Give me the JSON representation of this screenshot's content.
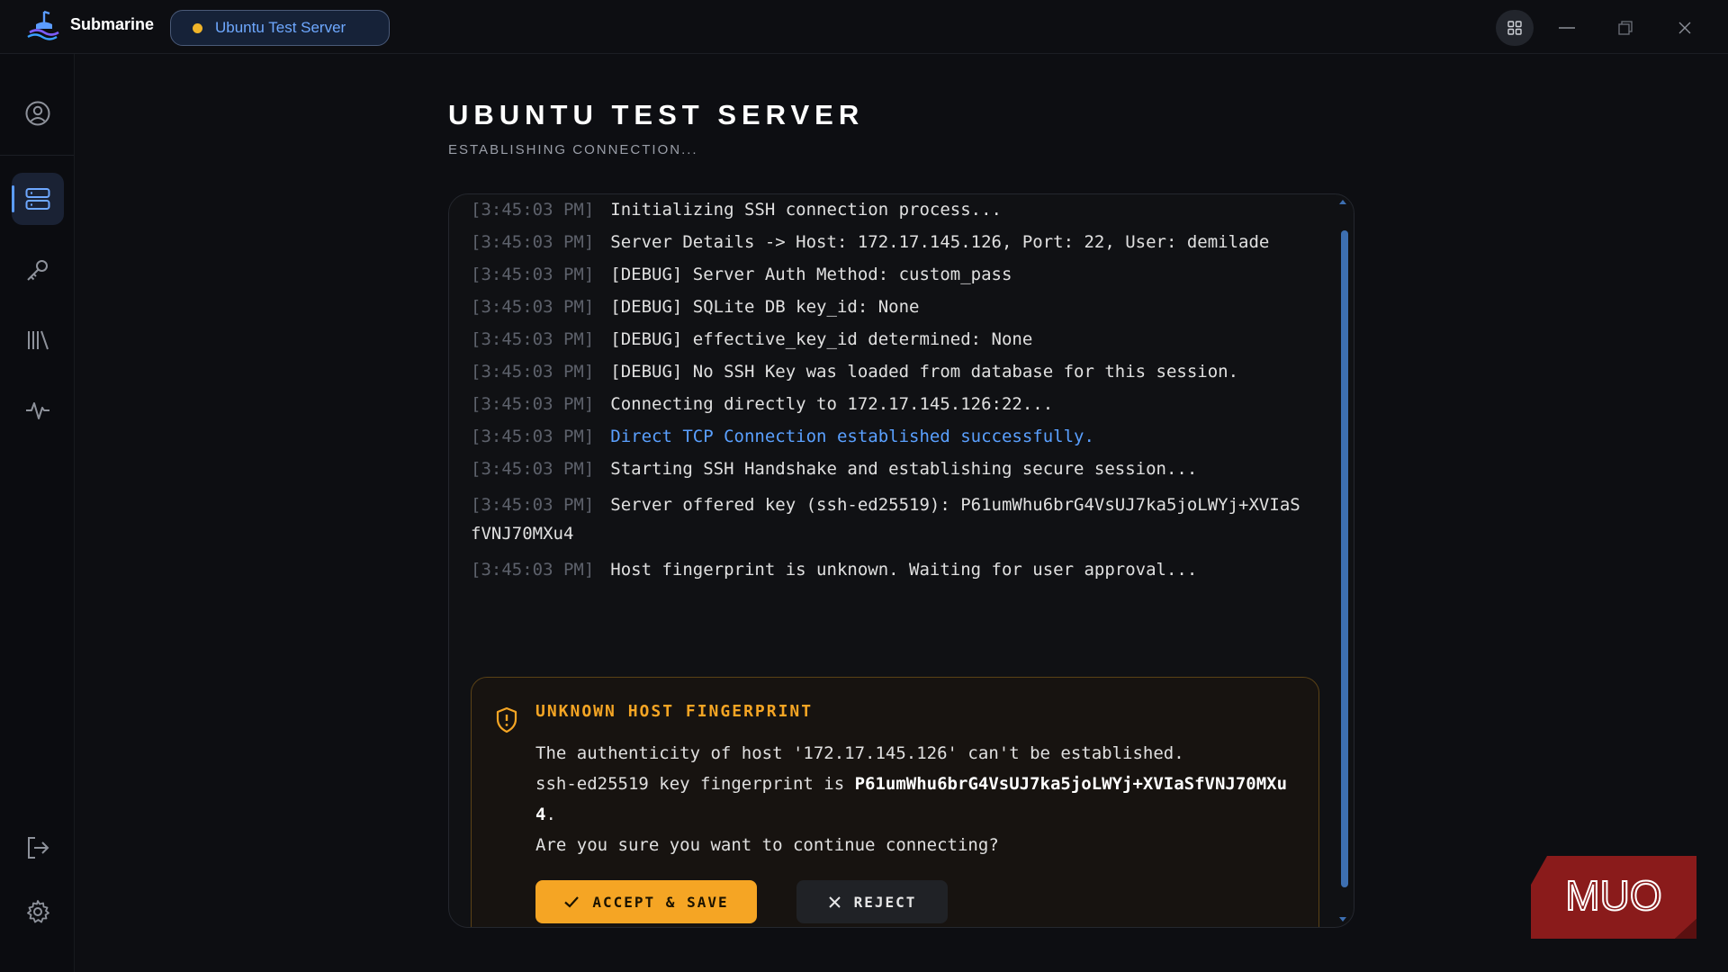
{
  "app": {
    "name": "Submarine"
  },
  "session_tab": {
    "label": "Ubuntu Test Server",
    "status_color": "#f0b429"
  },
  "window_controls": [
    "layout-grid-icon",
    "minimize-icon",
    "restore-icon",
    "close-icon"
  ],
  "sidebar": {
    "items": [
      {
        "name": "profile",
        "icon": "user-circle-icon"
      },
      {
        "name": "servers",
        "icon": "server-icon",
        "active": true
      },
      {
        "name": "keys",
        "icon": "key-icon"
      },
      {
        "name": "library",
        "icon": "library-icon"
      },
      {
        "name": "activity",
        "icon": "activity-pulse-icon"
      },
      {
        "name": "logout",
        "icon": "logout-icon"
      },
      {
        "name": "settings",
        "icon": "gear-icon"
      }
    ]
  },
  "page": {
    "title": "UBUNTU TEST SERVER",
    "subtitle": "ESTABLISHING CONNECTION..."
  },
  "log": [
    {
      "ts": "[3:45:03 PM]",
      "msg": "Initializing SSH connection process..."
    },
    {
      "ts": "[3:45:03 PM]",
      "msg": "Server Details -> Host: 172.17.145.126, Port: 22, User: demilade"
    },
    {
      "ts": "[3:45:03 PM]",
      "msg": "[DEBUG] Server Auth Method: custom_pass"
    },
    {
      "ts": "[3:45:03 PM]",
      "msg": "[DEBUG] SQLite DB key_id: None"
    },
    {
      "ts": "[3:45:03 PM]",
      "msg": "[DEBUG] effective_key_id determined: None"
    },
    {
      "ts": "[3:45:03 PM]",
      "msg": "[DEBUG] No SSH Key was loaded from database for this session."
    },
    {
      "ts": "[3:45:03 PM]",
      "msg": "Connecting directly to 172.17.145.126:22..."
    },
    {
      "ts": "[3:45:03 PM]",
      "msg": "Direct TCP Connection established successfully.",
      "level": "info"
    },
    {
      "ts": "[3:45:03 PM]",
      "msg": "Starting SSH Handshake and establishing secure session..."
    },
    {
      "ts": "[3:45:03 PM]",
      "msg": "Server offered key (ssh-ed25519): P61umWhu6brG4VsUJ7ka5joLWYj+XVIaSfVNJ70MXu4"
    },
    {
      "ts": "[3:45:03 PM]",
      "msg": "Host fingerprint is unknown. Waiting for user approval..."
    }
  ],
  "alert": {
    "icon": "shield-alert-icon",
    "title": "UNKNOWN HOST FINGERPRINT",
    "line1": "The authenticity of host '172.17.145.126' can't be established.",
    "line2_prefix": "ssh-ed25519 key fingerprint is ",
    "fingerprint": "P61umWhu6brG4VsUJ7ka5joLWYj+XVIaSfVNJ70MXu4",
    "line2_suffix": ".",
    "line3": "Are you sure you want to continue connecting?",
    "accept_label": "ACCEPT & SAVE",
    "reject_label": "REJECT",
    "accent_color": "#f5a524"
  },
  "watermark": {
    "text": "MUO"
  }
}
